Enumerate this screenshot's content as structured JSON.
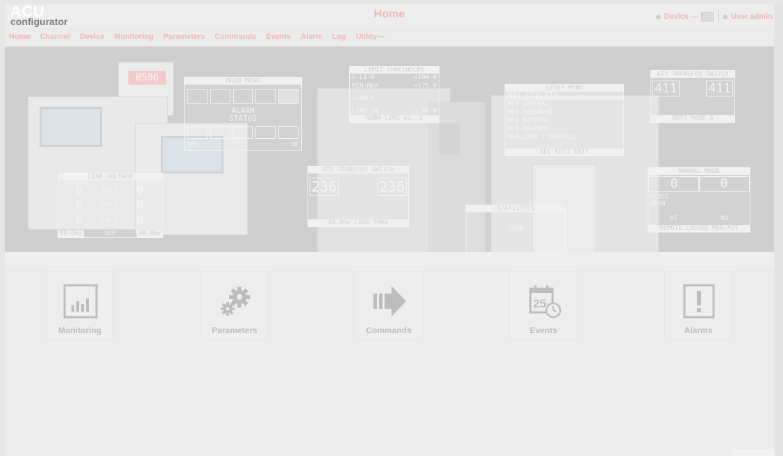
{
  "header": {
    "logo_top": "ACU",
    "logo_bottom": "configurator",
    "title": "Home",
    "device_label": "Device ---",
    "user_label": "User admin"
  },
  "nav": {
    "items": [
      "Home",
      "Channel",
      "Device",
      "Monitoring",
      "Parameters",
      "Commands",
      "Events",
      "Alarm",
      "Log",
      "Utility—"
    ]
  },
  "banner": {
    "main_menu": {
      "title": "MAIN MENU",
      "center1": "ALARM",
      "center2": "STATUS",
      "footer_left": "SEL",
      "footer_right": "OK"
    },
    "limit_thresholds": {
      "title": "LIMIT THRESHOLDS",
      "r1a": "U L1-N",
      "r1b": "+100.0",
      "r2a": "MIN-MAX",
      "r2b": "+175.9",
      "r3": "+119.0",
      "r4a": "LIM1 ON",
      "r4b": "+ 40.0",
      "footer": "NORM  LIM1  01..3"
    },
    "setup_menu": {
      "title": "SETUP MENU",
      "items": [
        "M01 UTILITY",
        "M02 GENERAL",
        "M03 PASSWORD",
        "M04 BATTERY",
        "M05 BREAKER",
        "M06 LINE 1 CONTROL"
      ],
      "footer": "SEL  EDIT  EXIT"
    },
    "ats_top": {
      "title": "ATS TRANSFER SWITCH",
      "v1": "411",
      "v2": "411",
      "footer": "AUTO   MODE   A"
    },
    "ats_mid": {
      "title": "ATS TRANSFER SWITCH",
      "v1": "236",
      "v2": "236",
      "footer": "48.9Hz  LOAD  50Hz"
    },
    "manual_mode": {
      "title": "MANUAL MODE",
      "v1": "0",
      "v2": "0",
      "close": "CLOSE",
      "open": "OPEN",
      "d1": "0I",
      "d2": "02",
      "footer": "REMOTE LOCKED  MAN/AUT"
    },
    "statistics": {
      "title": "STATISTICS",
      "mid": "LOAD"
    },
    "line_voltage": {
      "title": "LINE VOLTAGE",
      "rows": [
        "L1L2",
        "L2L3",
        "L3L1"
      ],
      "value": "0",
      "footer_left": "00.0Hz",
      "footer_mid": "OFF",
      "footer_right": "00.0Hz"
    },
    "display_value": "0500"
  },
  "tiles": [
    {
      "label": "Monitoring",
      "icon": "monitoring-icon"
    },
    {
      "label": "Parameters",
      "icon": "gears-icon"
    },
    {
      "label": "Commands",
      "icon": "arrow-right-icon"
    },
    {
      "label": "Events",
      "icon": "calendar-clock-icon"
    },
    {
      "label": "Alarms",
      "icon": "alarm-exclamation-icon"
    }
  ],
  "colors": {
    "accent": "#f0b8b8",
    "tile_label": "#bdbdbd",
    "icon": "#bdbdbd"
  }
}
